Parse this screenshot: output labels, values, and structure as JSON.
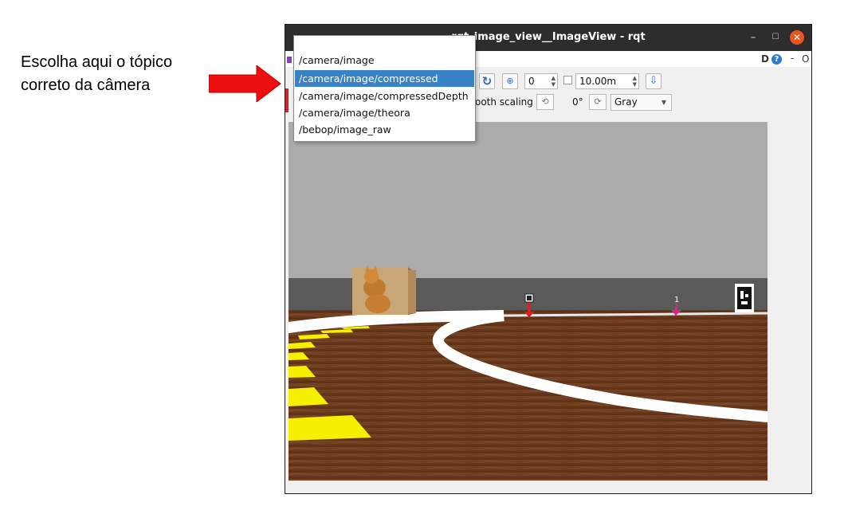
{
  "annotation": {
    "line1": "Escolha aqui o tópico",
    "line2": "correto da câmera",
    "arrow_color": "#ee1010"
  },
  "window": {
    "title": "rqt_image_view__ImageView - rqt",
    "close_color": "#e95420",
    "top_right": {
      "d_label": "D",
      "dash": "-",
      "o_label": "O"
    }
  },
  "topic_dropdown": {
    "items": [
      {
        "label": "/camera/image",
        "selected": false
      },
      {
        "label": "/camera/image/compressed",
        "selected": true
      },
      {
        "label": "/camera/image/compressedDepth",
        "selected": false
      },
      {
        "label": "/camera/image/theora",
        "selected": false
      },
      {
        "label": "/bebop/image_raw",
        "selected": false
      }
    ],
    "selection_color": "#3a82c6"
  },
  "toolbar": {
    "zoom_value": "0",
    "distance_value": "10.00m",
    "smooth_label": "ooth scaling",
    "rotation_label": "0°",
    "color_scheme": "Gray",
    "icons": [
      "refresh-icon",
      "zoom-fit-icon",
      "save-icon",
      "rotate-left-icon",
      "rotate-right-icon"
    ]
  },
  "scene": {
    "marker_1_label": "1",
    "floor_color": "#6b3a1e",
    "wall_color": "#5a5a5a",
    "sky_color": "#ababab",
    "line_white": "#ffffff",
    "line_yellow": "#f5ef00"
  }
}
